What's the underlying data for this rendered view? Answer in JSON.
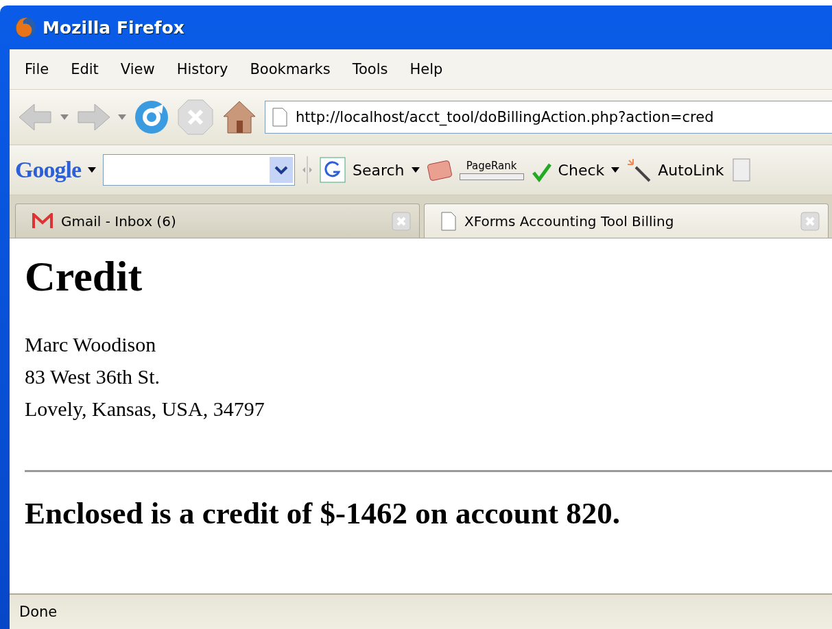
{
  "window": {
    "title": "Mozilla Firefox"
  },
  "menu": [
    "File",
    "Edit",
    "View",
    "History",
    "Bookmarks",
    "Tools",
    "Help"
  ],
  "address": {
    "value": "http://localhost/acct_tool/doBillingAction.php?action=cred"
  },
  "google_toolbar": {
    "logo": "Google",
    "search_label": "Search",
    "pagerank_label": "PageRank",
    "check_label": "Check",
    "autolink_label": "AutoLink"
  },
  "tabs": [
    {
      "label": "Gmail - Inbox (6)",
      "kind": "mail",
      "selected": false
    },
    {
      "label": "XForms Accounting Tool Billing",
      "kind": "page",
      "selected": true
    }
  ],
  "page": {
    "heading": "Credit",
    "address_lines": [
      "Marc Woodison",
      "83 West 36th St.",
      "Lovely, Kansas, USA, 34797"
    ],
    "message": "Enclosed is a credit of $-1462 on account 820."
  },
  "status_bar": {
    "text": "Done"
  }
}
